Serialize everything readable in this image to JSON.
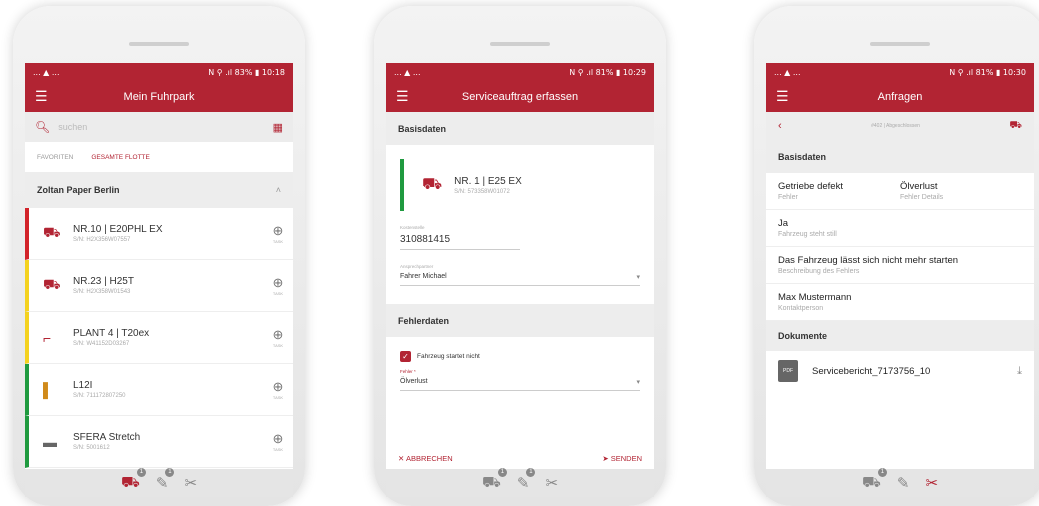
{
  "phone1": {
    "status": {
      "left": "... ▲ ...",
      "right": "N ⚲ .ıl 83% ▮ 10:18"
    },
    "title": "Mein Fuhrpark",
    "search_placeholder": "suchen",
    "tabs": {
      "favorites": "FAVORITEN",
      "fleet": "GESAMTE FLOTTE"
    },
    "group": "Zoltan Paper Berlin",
    "vehicles": [
      {
        "name": "NR.10 | E20PHL EX",
        "sn": "S/N: H2X356W07557",
        "color": "#d2232a"
      },
      {
        "name": "NR.23 | H25T",
        "sn": "S/N: H2X358W01543",
        "color": "#f4d21f"
      },
      {
        "name": "PLANT 4 | T20ex",
        "sn": "S/N: W41152D03267",
        "color": "#f4d21f"
      },
      {
        "name": "L12I",
        "sn": "S/N: 711172807250",
        "color": "#1f9a3f"
      },
      {
        "name": "SFERA Stretch",
        "sn": "S/N: 5001612",
        "color": "#1f9a3f"
      }
    ],
    "add_label": "TASK"
  },
  "phone2": {
    "status": {
      "left": "... ▲ ...",
      "right": "N ⚲ .ıl 81% ▮ 10:29"
    },
    "title": "Serviceauftrag erfassen",
    "section1": "Basisdaten",
    "vehicle": {
      "name": "NR. 1 | E25 EX",
      "sn": "S/N: 573358W01072"
    },
    "field1_label": "Kostenstelle",
    "field1_value": "310881415",
    "field2_label": "Ansprechpartner",
    "field2_value": "Fahrer Michael",
    "section2": "Fehlerdaten",
    "checkbox_label": "Fahrzeug startet nicht",
    "fehler_label": "Fehler *",
    "fehler_value": "Ölverlust",
    "cancel": "✕ ABBRECHEN",
    "send": "➤ SENDEN"
  },
  "phone3": {
    "status": {
      "left": "... ▲ ...",
      "right": "N ⚲ .ıl 81% ▮ 10:30"
    },
    "title": "Anfragen",
    "subbar_mid": "#402 | Abgeschlossen",
    "section1": "Basisdaten",
    "row1a": {
      "v": "Getriebe defekt",
      "l": "Fehler"
    },
    "row1b": {
      "v": "Ölverlust",
      "l": "Fehler Details"
    },
    "row2": {
      "v": "Ja",
      "l": "Fahrzeug steht still"
    },
    "row3": {
      "v": "Das Fahrzeug lässt sich nicht mehr starten",
      "l": "Beschreibung des Fehlers"
    },
    "row4": {
      "v": "Max Mustermann",
      "l": "Kontaktperson"
    },
    "section2": "Dokumente",
    "doc": "Servicebericht_7173756_10",
    "pdf": "PDF"
  },
  "nav": {
    "badge1": "1",
    "badge2": "1"
  }
}
